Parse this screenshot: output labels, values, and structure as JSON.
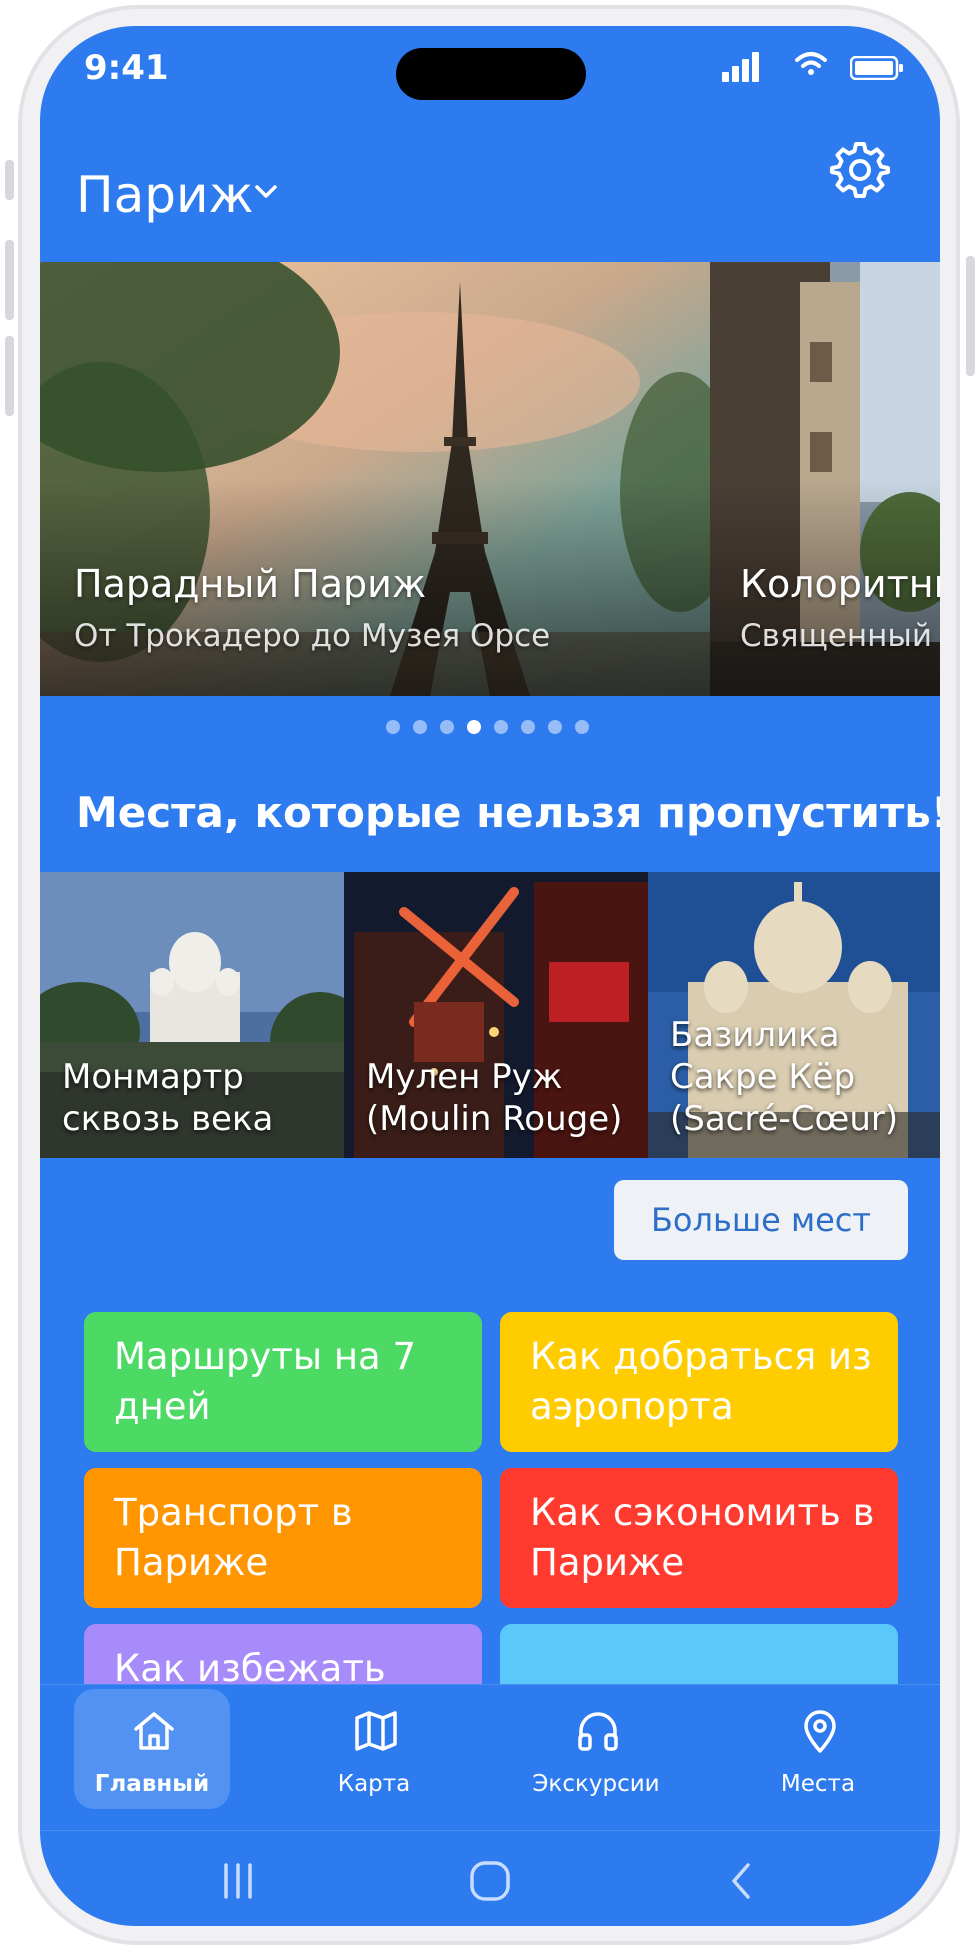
{
  "status_bar": {
    "time": "9:41"
  },
  "header": {
    "city": "Париж"
  },
  "carousel": {
    "slides": [
      {
        "title": "Парадный Париж",
        "subtitle": "От Трокадеро до Музея Орсе"
      },
      {
        "title": "Колоритны",
        "subtitle": "Священный"
      }
    ],
    "dot_count": 8,
    "active_dot": 3
  },
  "must_see": {
    "title": "Места, которые нельзя пропустить!",
    "places": [
      {
        "label": "Монмартр сквозь века"
      },
      {
        "label": "Мулен Руж (Moulin Rouge)"
      },
      {
        "label": "Базилика Сакре Кёр (Sacré-Cœur)"
      }
    ],
    "more_button": "Больше мест"
  },
  "tiles": [
    {
      "label": "Маршруты на 7 дней",
      "color": "#4cd964"
    },
    {
      "label": "Как добраться из аэропорта",
      "color": "#ffcc00"
    },
    {
      "label": "Транспорт в Париже",
      "color": "#ff9500"
    },
    {
      "label": "Как сэкономить в Париже",
      "color": "#ff3b30"
    },
    {
      "label": "Как избежать",
      "color": "#a78bfa"
    },
    {
      "label": "",
      "color": "#5ac8fa"
    }
  ],
  "tabbar": {
    "tabs": [
      {
        "label": "Главный",
        "icon": "home-icon",
        "active": true
      },
      {
        "label": "Карта",
        "icon": "map-icon",
        "active": false
      },
      {
        "label": "Экскурсии",
        "icon": "headphones-icon",
        "active": false
      },
      {
        "label": "Места",
        "icon": "location-pin-icon",
        "active": false
      }
    ]
  },
  "colors": {
    "background": "#2d7bef",
    "white": "#ffffff"
  }
}
